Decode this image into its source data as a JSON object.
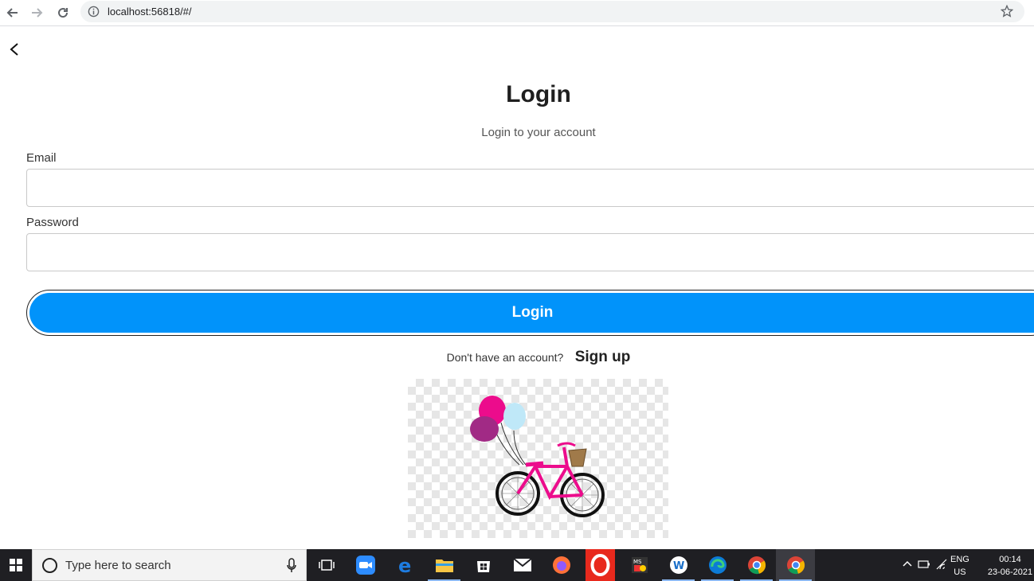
{
  "browser": {
    "url": "localhost:56818/#/"
  },
  "page": {
    "title": "Login",
    "subtitle": "Login to your account",
    "email_label": "Email",
    "email_value": "",
    "password_label": "Password",
    "password_value": "",
    "login_button": "Login",
    "signup_prompt": "Don't have an account?",
    "signup_link": "Sign up"
  },
  "taskbar": {
    "search_placeholder": "Type here to search",
    "lang_line1": "ENG",
    "lang_line2": "US",
    "time": "00:14",
    "date": "23-06-2021",
    "apps": [
      "task-view",
      "zoom",
      "edge-legacy",
      "file-explorer",
      "microsoft-store",
      "mail",
      "firefox",
      "opera",
      "multimedia",
      "app-w",
      "edge",
      "chrome",
      "chrome-active"
    ]
  },
  "colors": {
    "accent": "#0193fa",
    "taskbar": "#1f1f23"
  }
}
